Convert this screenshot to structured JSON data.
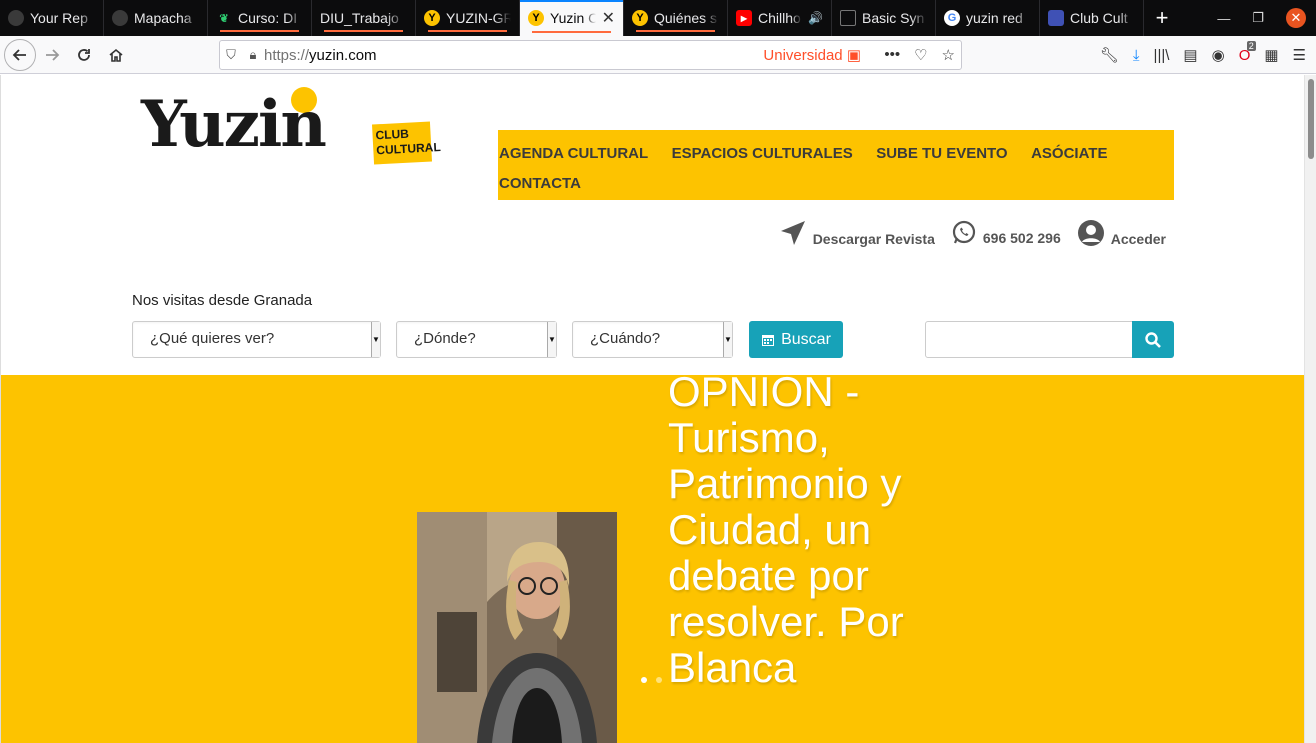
{
  "browser": {
    "tabs": [
      {
        "label": "Your Rep",
        "favicon_color": "#3a3a3a",
        "underline": false,
        "active": false
      },
      {
        "label": "Mapacha",
        "favicon_color": "#3a3a3a",
        "underline": false,
        "active": false
      },
      {
        "label": "Curso: DI",
        "favicon_color": "#2ecc71",
        "underline": true,
        "active": false
      },
      {
        "label": "DIU_Trabajo",
        "favicon_color": "#0c0c0d",
        "underline": true,
        "active": false
      },
      {
        "label": "YUZIN-GR",
        "favicon_color": "#fdc300",
        "underline": true,
        "active": false
      },
      {
        "label": "Yuzin C",
        "favicon_color": "#fdc300",
        "underline": true,
        "active": true
      },
      {
        "label": "Quiénes s",
        "favicon_color": "#fdc300",
        "underline": true,
        "active": false
      },
      {
        "label": "Chillho",
        "favicon_color": "#ff0000",
        "underline": false,
        "active": false
      },
      {
        "label": "Basic Syn",
        "favicon_color": "#555555",
        "underline": false,
        "active": false
      },
      {
        "label": "yuzin red",
        "favicon_color": "#4285f4",
        "underline": false,
        "active": false
      },
      {
        "label": "Club Cult",
        "favicon_color": "#3f51b5",
        "underline": false,
        "active": false
      }
    ],
    "url_prefix": "https://",
    "url_host": "yuzin.com",
    "container_label": "Universidad",
    "notification_count": "2"
  },
  "site": {
    "logo_word": "Yuzin",
    "logo_tag_line1": "CLUB",
    "logo_tag_line2": "CULTURAL",
    "nav": [
      "AGENDA CULTURAL",
      "ESPACIOS CULTURALES",
      "SUBE TU EVENTO",
      "ASÓCIATE",
      "CONTACTA"
    ],
    "util": {
      "download": "Descargar Revista",
      "phone": "696 502 296",
      "login": "Acceder"
    },
    "visit_text": "Nos visitas desde Granada",
    "filters": {
      "what": "¿Qué quieres ver?",
      "where": "¿Dónde?",
      "when": "¿Cuándo?",
      "search_button": "Buscar"
    },
    "hero_title": "OPNION - Turismo, Patrimonio y Ciudad, un debate por resolver. Por Blanca",
    "accent_color": "#fdc300",
    "button_color": "#17a2b8"
  }
}
